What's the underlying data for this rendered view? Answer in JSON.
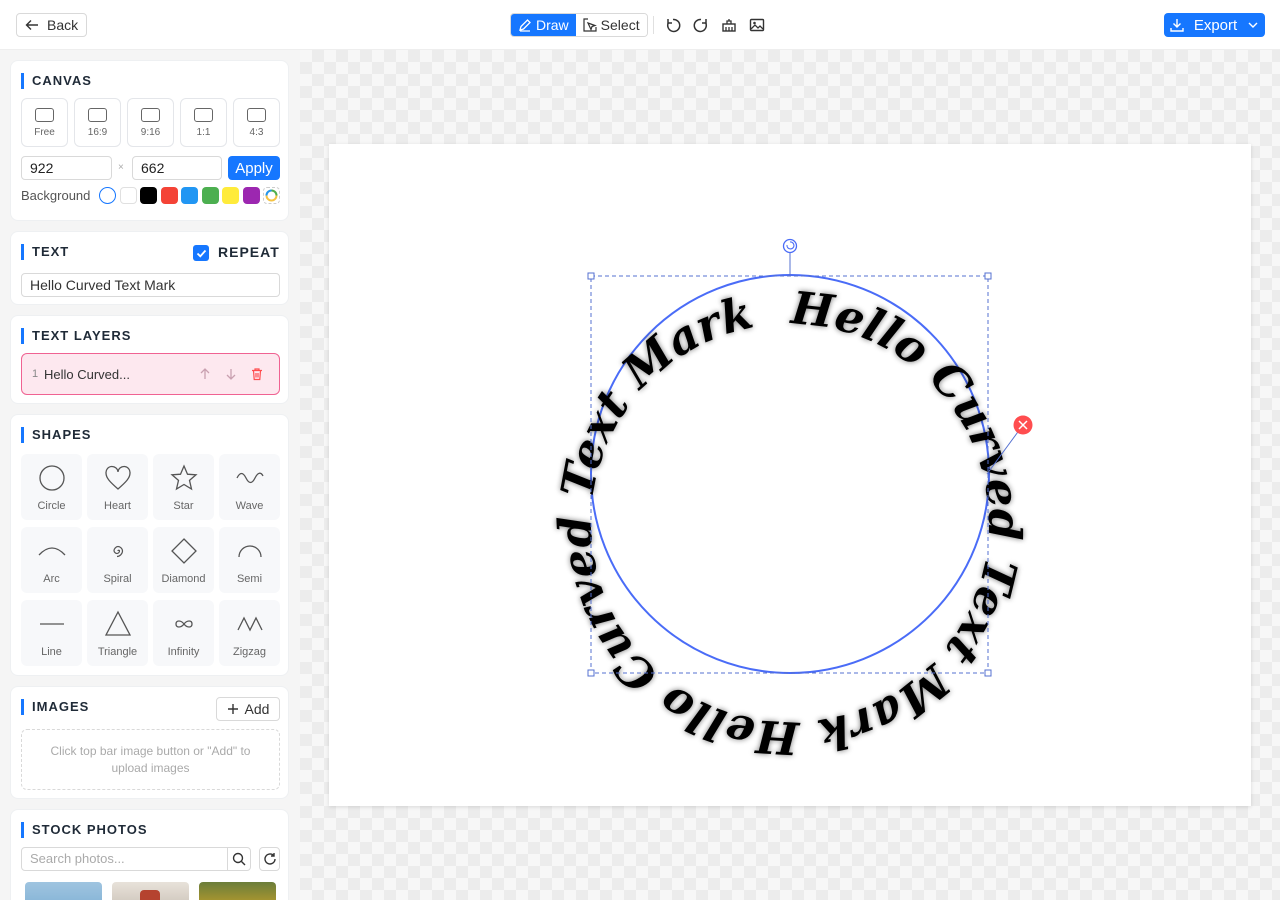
{
  "toolbar": {
    "back_label": "Back",
    "draw_label": "Draw",
    "select_label": "Select",
    "export_label": "Export",
    "icons": [
      "undo-icon",
      "redo-icon",
      "clear-icon",
      "image-icon"
    ]
  },
  "canvas_panel": {
    "title": "CANVAS",
    "ratios": [
      "Free",
      "16:9",
      "9:16",
      "1:1",
      "4:3"
    ],
    "width": "922",
    "height": "662",
    "times": "×",
    "apply_label": "Apply",
    "background_label": "Background",
    "swatches": [
      "#ffffff",
      "#ffffff",
      "#000000",
      "#f44336",
      "#2196f3",
      "#4caf50",
      "#ffeb3b",
      "#9c27b0"
    ]
  },
  "text_panel": {
    "title": "TEXT",
    "repeat_label": "REPEAT",
    "repeat_checked": true,
    "value": "Hello Curved Text Mark"
  },
  "layers_panel": {
    "title": "TEXT LAYERS",
    "layers": [
      {
        "index": "1",
        "name": "Hello Curved..."
      }
    ]
  },
  "shapes_panel": {
    "title": "SHAPES",
    "shapes": [
      "Circle",
      "Heart",
      "Star",
      "Wave",
      "Arc",
      "Spiral",
      "Diamond",
      "Semi",
      "Line",
      "Triangle",
      "Infinity",
      "Zigzag"
    ]
  },
  "images_panel": {
    "title": "IMAGES",
    "add_label": "Add",
    "hint": "Click top bar image button or \"Add\" to upload images"
  },
  "stock_panel": {
    "title": "STOCK PHOTOS",
    "search_placeholder": "Search photos..."
  },
  "artwork": {
    "curved_text": "Hello Curved Text Mark Hello Curved Text Mark",
    "text_color": "#000000",
    "path_color": "#4a6cf7"
  },
  "colors": {
    "accent": "#1677ff",
    "delete": "#ff4d4f"
  }
}
